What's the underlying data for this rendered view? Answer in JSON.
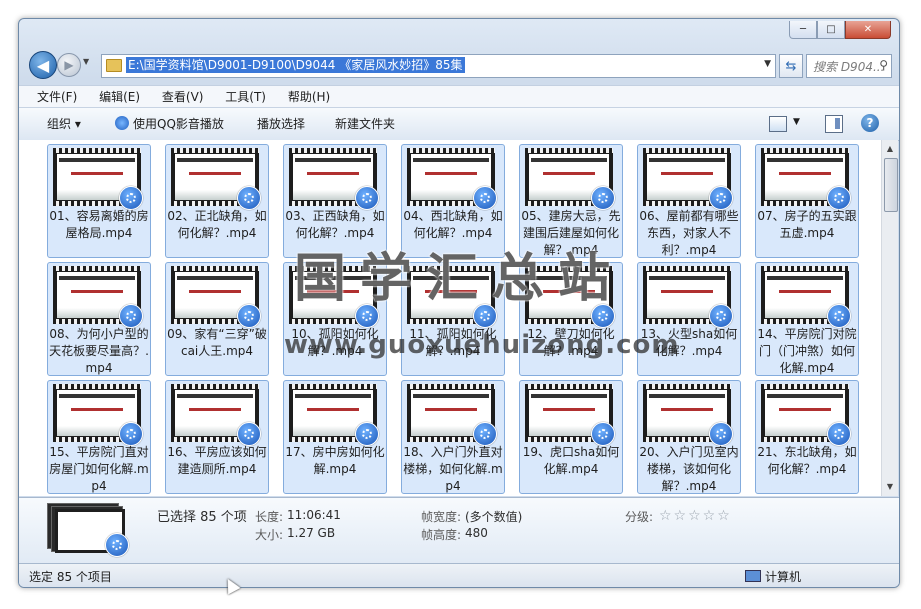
{
  "window": {
    "address": "E:\\国学资料馆\\D9001-D9100\\D9044 《家居风水妙招》85集",
    "search_placeholder": "搜索 D904...",
    "controls": [
      "─",
      "□",
      "✕"
    ]
  },
  "menu": [
    "文件(F)",
    "编辑(E)",
    "查看(V)",
    "工具(T)",
    "帮助(H)"
  ],
  "commands": {
    "organize": "组织 ▾",
    "play_qq": "使用QQ影音播放",
    "play_selection": "播放选择",
    "new_folder": "新建文件夹"
  },
  "files": [
    "01、容易离婚的房屋格局.mp4",
    "02、正北缺角，如何化解？.mp4",
    "03、正西缺角，如何化解？.mp4",
    "04、西北缺角，如何化解？.mp4",
    "05、建房大忌，先建围后建屋如何化解？.mp4",
    "06、屋前都有哪些东西，对家人不利？.mp4",
    "07、房子的五实跟五虚.mp4",
    "08、为何小户型的天花板要尽量高？.mp4",
    "09、家有“三穿”破cai人王.mp4",
    "10、孤阳如何化解？.mp4",
    "11、孤阳如何化解？.mp4",
    "12、壁刀如何化解？.mp4",
    "13、火型sha如何化解？.mp4",
    "14、平房院门对院门（门冲煞）如何化解.mp4",
    "15、平房院门直对房屋门如何化解.mp4",
    "16、平房应该如何建造厕所.mp4",
    "17、房中房如何化解.mp4",
    "18、入户门外直对楼梯，如何化解.mp4",
    "19、虎口sha如何化解.mp4",
    "20、入户门见室内楼梯，该如何化解？.mp4",
    "21、东北缺角，如何化解？.mp4"
  ],
  "watermark": {
    "title": "国学汇总站",
    "url": "www.guoxuehuizong.com"
  },
  "details": {
    "selected": "已选择 85 个项",
    "length_key": "长度:",
    "length_val": "11:06:41",
    "size_key": "大小:",
    "size_val": "1.27 GB",
    "width_key": "帧宽度:",
    "width_val": "(多个数值)",
    "height_key": "帧高度:",
    "height_val": "480",
    "rating_key": "分级:",
    "rating_stars": "☆☆☆☆☆"
  },
  "status": {
    "left": "选定 85 个项目",
    "right": "计算机"
  }
}
